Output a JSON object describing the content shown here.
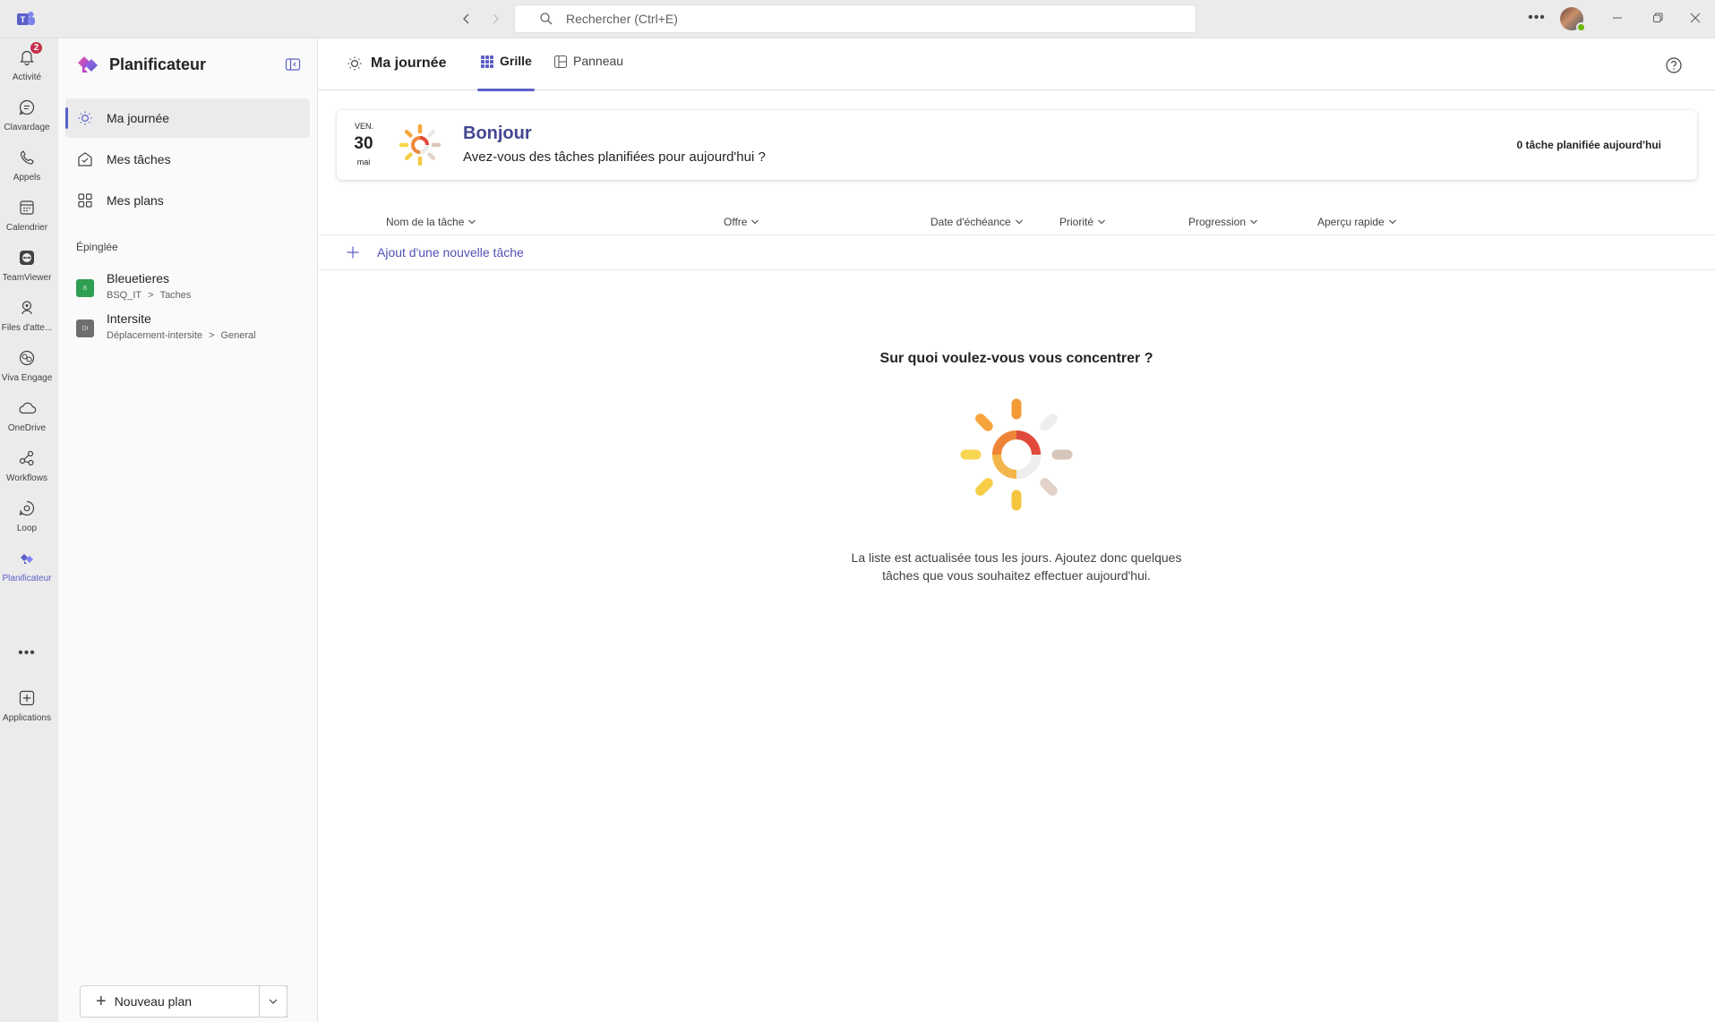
{
  "titlebar": {
    "search_placeholder": "Rechercher (Ctrl+E)"
  },
  "rail": {
    "items": [
      {
        "label": "Activité",
        "icon": "bell-icon",
        "badge": "2"
      },
      {
        "label": "Clavardage",
        "icon": "chat-icon"
      },
      {
        "label": "Appels",
        "icon": "phone-icon"
      },
      {
        "label": "Calendrier",
        "icon": "calendar-icon"
      },
      {
        "label": "TeamViewer",
        "icon": "teamviewer-icon"
      },
      {
        "label": "Files d'atte...",
        "icon": "queues-icon"
      },
      {
        "label": "Viva Engage",
        "icon": "viva-engage-icon"
      },
      {
        "label": "OneDrive",
        "icon": "cloud-icon"
      },
      {
        "label": "Workflows",
        "icon": "workflows-icon"
      },
      {
        "label": "Loop",
        "icon": "loop-icon"
      },
      {
        "label": "Planificateur",
        "icon": "planner-icon"
      },
      {
        "label": "Applications",
        "icon": "add-apps-icon"
      }
    ]
  },
  "sidebar": {
    "title": "Planificateur",
    "nav": [
      {
        "label": "Ma journée",
        "icon": "sun-icon"
      },
      {
        "label": "Mes tâches",
        "icon": "task-check-icon"
      },
      {
        "label": "Mes plans",
        "icon": "grid-icon"
      }
    ],
    "pinned_title": "Épinglée",
    "pinned": [
      {
        "name": "Bleuetieres",
        "path_a": "BSQ_IT",
        "path_b": "Taches",
        "color": "#2e9e52",
        "initials": "B"
      },
      {
        "name": "Intersite",
        "path_a": "Déplacement-intersite",
        "path_b": "General",
        "color": "#6e6e6e",
        "initials": "DI"
      }
    ],
    "new_plan_label": "Nouveau plan"
  },
  "main": {
    "title": "Ma journée",
    "tabs": [
      {
        "label": "Grille",
        "icon": "grid-dots-icon"
      },
      {
        "label": "Panneau",
        "icon": "board-icon"
      }
    ],
    "banner": {
      "day": "VEN.",
      "date": "30",
      "month": "mai",
      "greeting": "Bonjour",
      "subtitle": "Avez-vous des tâches planifiées pour aujourd'hui ?",
      "count": "0 tâche planifiée aujourd'hui"
    },
    "columns": [
      "Nom de la tâche",
      "Offre",
      "Date d'échéance",
      "Priorité",
      "Progression",
      "Aperçu rapide"
    ],
    "add_task_label": "Ajout d'une nouvelle tâche",
    "empty": {
      "title": "Sur quoi voulez-vous vous concentrer ?",
      "text": "La liste est actualisée tous les jours. Ajoutez donc quelques tâches que vous souhaitez effectuer aujourd'hui."
    }
  },
  "colors": {
    "accent": "#5b5fc7",
    "greeting": "#444791",
    "badge": "#c4314b"
  }
}
